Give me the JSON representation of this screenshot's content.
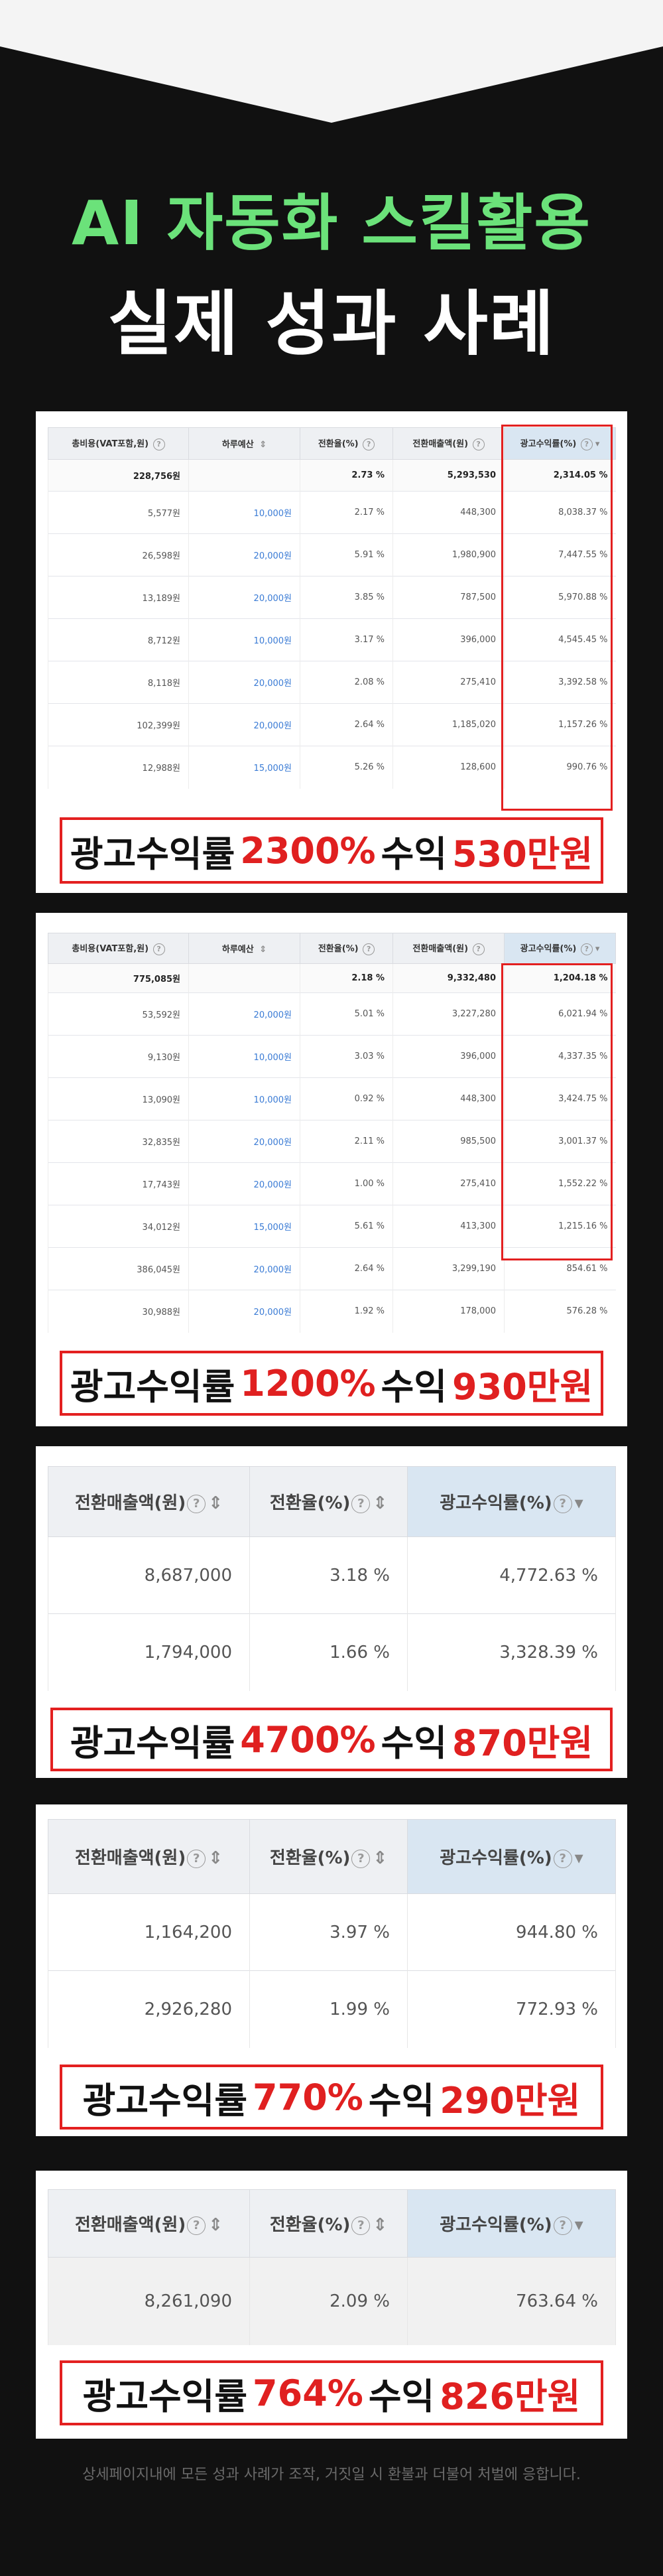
{
  "headline": {
    "line1": "AI 자동화 스킬활용",
    "line2": "실제 성과 사례"
  },
  "colors": {
    "background": "#111111",
    "headline_green": "#6BE27A",
    "accent_red": "#e02020"
  },
  "icons": {
    "help": "?",
    "sort": "⇕",
    "sort_desc": "▾"
  },
  "case1": {
    "headers": [
      "총비용(VAT포함,원)",
      "하루예산",
      "전환율(%)",
      "전환매출액(원)",
      "광고수익률(%)"
    ],
    "summary": [
      "228,756원",
      "",
      "2.73 %",
      "5,293,530",
      "2,314.05 %"
    ],
    "rows": [
      [
        "5,577원",
        "10,000원",
        "2.17 %",
        "448,300",
        "8,038.37 %"
      ],
      [
        "26,598원",
        "20,000원",
        "5.91 %",
        "1,980,900",
        "7,447.55 %"
      ],
      [
        "13,189원",
        "20,000원",
        "3.85 %",
        "787,500",
        "5,970.88 %"
      ],
      [
        "8,712원",
        "10,000원",
        "3.17 %",
        "396,000",
        "4,545.45 %"
      ],
      [
        "8,118원",
        "20,000원",
        "2.08 %",
        "275,410",
        "3,392.58 %"
      ],
      [
        "102,399원",
        "20,000원",
        "2.64 %",
        "1,185,020",
        "1,157.26 %"
      ],
      [
        "12,988원",
        "15,000원",
        "5.26 %",
        "128,600",
        "990.76 %"
      ]
    ],
    "caption": {
      "pre": "광고수익률",
      "rate": "2300%",
      "mid": "수익",
      "amount": "530만원"
    }
  },
  "case2": {
    "headers": [
      "총비용(VAT포함,원)",
      "하루예산",
      "전환율(%)",
      "전환매출액(원)",
      "광고수익률(%)"
    ],
    "summary": [
      "775,085원",
      "",
      "2.18 %",
      "9,332,480",
      "1,204.18 %"
    ],
    "rows": [
      [
        "53,592원",
        "20,000원",
        "5.01 %",
        "3,227,280",
        "6,021.94 %"
      ],
      [
        "9,130원",
        "10,000원",
        "3.03 %",
        "396,000",
        "4,337.35 %"
      ],
      [
        "13,090원",
        "10,000원",
        "0.92 %",
        "448,300",
        "3,424.75 %"
      ],
      [
        "32,835원",
        "20,000원",
        "2.11 %",
        "985,500",
        "3,001.37 %"
      ],
      [
        "17,743원",
        "20,000원",
        "1.00 %",
        "275,410",
        "1,552.22 %"
      ],
      [
        "34,012원",
        "15,000원",
        "5.61 %",
        "413,300",
        "1,215.16 %"
      ],
      [
        "386,045원",
        "20,000원",
        "2.64 %",
        "3,299,190",
        "854.61 %"
      ],
      [
        "30,988원",
        "20,000원",
        "1.92 %",
        "178,000",
        "576.28 %"
      ]
    ],
    "caption": {
      "pre": "광고수익률",
      "rate": "1200%",
      "mid": "수익",
      "amount": "930만원"
    }
  },
  "case3": {
    "headers": [
      "전환매출액(원)",
      "전환율(%)",
      "광고수익률(%)"
    ],
    "rows": [
      [
        "8,687,000",
        "3.18 %",
        "4,772.63 %"
      ],
      [
        "1,794,000",
        "1.66 %",
        "3,328.39 %"
      ]
    ],
    "caption": {
      "pre": "광고수익률",
      "rate": "4700%",
      "mid": "수익",
      "amount": "870만원"
    }
  },
  "case4": {
    "headers": [
      "전환매출액(원)",
      "전환율(%)",
      "광고수익률(%)"
    ],
    "rows": [
      [
        "1,164,200",
        "3.97 %",
        "944.80 %"
      ],
      [
        "2,926,280",
        "1.99 %",
        "772.93 %"
      ]
    ],
    "caption": {
      "pre": "광고수익률",
      "rate": "770%",
      "mid": "수익",
      "amount": "290만원"
    }
  },
  "case5": {
    "headers": [
      "전환매출액(원)",
      "전환율(%)",
      "광고수익률(%)"
    ],
    "rows": [
      [
        "8,261,090",
        "2.09 %",
        "763.64 %"
      ]
    ],
    "caption": {
      "pre": "광고수익률",
      "rate": "764%",
      "mid": "수익",
      "amount": "826만원"
    }
  },
  "footer": "상세페이지내에 모든 성과 사례가 조작, 거짓일 시 환불과 더불어 처벌에 응합니다."
}
